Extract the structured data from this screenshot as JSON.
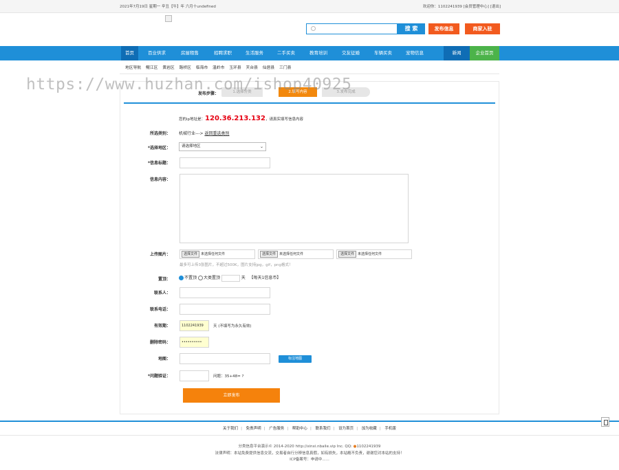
{
  "topbar": {
    "date_text": "2021年7月19日 星期一 辛丑【牛】年 六月十undefined",
    "welcome_text": "欢迎你：1102241939 [会员管理中心] [退出]"
  },
  "header": {
    "search_button": "搜 索",
    "publish_button": "发布信息",
    "shop_button": "商家入驻"
  },
  "nav": {
    "items": [
      "首页",
      "百业供求",
      "房屋租售",
      "招聘求职",
      "生活服务",
      "二手买卖",
      "教育培训",
      "交友征婚",
      "车辆买卖",
      "宠物信息",
      "新闻",
      "企业首页"
    ]
  },
  "subnav": {
    "items": [
      "地区导航",
      "鲲江区",
      "黄岩区",
      "路桥区",
      "临海市",
      "温岭市",
      "玉环县",
      "天台县",
      "仙居县",
      "三门县"
    ]
  },
  "watermark": "https://www.huzhan.com/ishop40925",
  "steps": {
    "label": "发布步骤：",
    "items": [
      "1.选择分类",
      "2.填写内容",
      "3.发布完成"
    ]
  },
  "form": {
    "ip_prefix": "您的ip地址是：",
    "ip": "120.36.213.132",
    "ip_suffix": "，请真实填写信息内容",
    "category_label": "所选类别：",
    "category_value": "机械行业--->",
    "category_link": "返回重选类别",
    "region_label": "*选择地区：",
    "region_value": "请选择地区",
    "title_label": "*信息标题：",
    "content_label": "信息内容：",
    "upload_label": "上传图片：",
    "file_button": "选择文件",
    "file_none": "未选择任何文件",
    "upload_hint": "最多可上传3张图片，不超过500K，图片支持jpg，gif，png格式！",
    "top_label": "置顶：",
    "top_option_none": "不置顶",
    "top_option_cat": "大类置顶",
    "top_days": "天",
    "top_price": "【每天1信息币】",
    "contact_label": "联系人：",
    "phone_label": "联系电话：",
    "valid_label": "有效期：",
    "valid_value": "1102241939",
    "valid_hint": "天 (不填写为永久有效)",
    "delpwd_label": "删除密码：",
    "delpwd_value": "••••••••••",
    "map_label": "地图：",
    "map_button": "标注地图",
    "verify_label": "*问题验证：",
    "verify_question": "问题：35+48= ?",
    "submit_button": "立即发布"
  },
  "footer": {
    "links": [
      "关于我们",
      "免责声明",
      "广告服务",
      "帮助中心",
      "联系我们",
      "设为首页",
      "加为收藏",
      "手机版"
    ],
    "copyright": "分类信息平台演示© 2014-2020 http://xinxi.nbaile.vip Inc. QQ:",
    "qq": "1102241939",
    "disclaimer": "法律声明：本站免费提供信息交流，交易者自行分辨信息真假，如有损失，本站概不负责，谢谢您对本站的支持！",
    "icp": "ICP备案号：申请中......"
  },
  "colors": {
    "brand_blue": "#1f8fd8",
    "accent_orange": "#f25a1e",
    "submit_orange": "#f5820c",
    "ip_red": "#e60012",
    "enterprise_green": "#4cb34a"
  }
}
